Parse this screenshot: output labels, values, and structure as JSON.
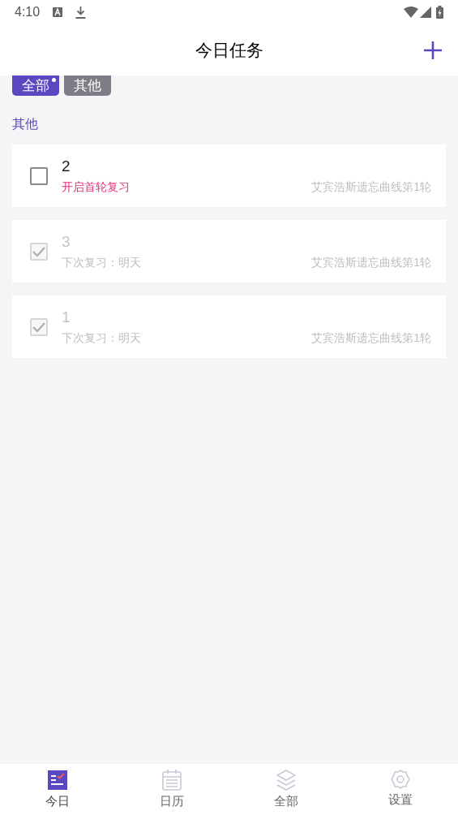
{
  "status_bar": {
    "time": "4:10"
  },
  "header": {
    "title": "今日任务"
  },
  "filters": [
    {
      "label": "全部",
      "selected": true,
      "dot": true
    },
    {
      "label": "其他",
      "selected": false,
      "dot": false
    }
  ],
  "section": {
    "title": "其他"
  },
  "tasks": [
    {
      "title": "2",
      "note": "开启首轮复习",
      "plan": "艾宾浩斯遗忘曲线第1轮",
      "checked": false
    },
    {
      "title": "3",
      "note": "下次复习：明天",
      "plan": "艾宾浩斯遗忘曲线第1轮",
      "checked": true
    },
    {
      "title": "1",
      "note": "下次复习：明天",
      "plan": "艾宾浩斯遗忘曲线第1轮",
      "checked": true
    }
  ],
  "nav": [
    {
      "kind": "today",
      "label": "今日",
      "selected": true
    },
    {
      "kind": "calendar",
      "label": "日历",
      "selected": false
    },
    {
      "kind": "layers",
      "label": "全部",
      "selected": false
    },
    {
      "kind": "settings",
      "label": "设置",
      "selected": false
    }
  ]
}
